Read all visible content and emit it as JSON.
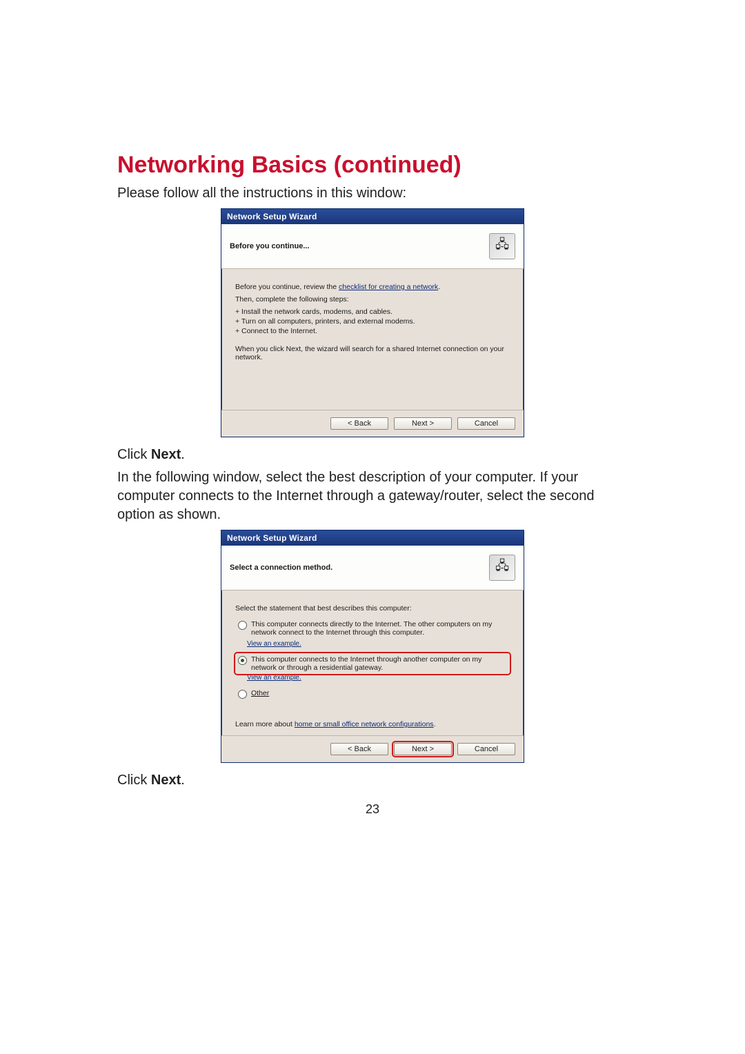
{
  "title": "Networking Basics (continued)",
  "intro": "Please follow all the instructions in this window:",
  "click_next_1": "Click ",
  "click_next_bold": "Next",
  "click_next_period": ".",
  "midtext": "In the following window, select the best description of your computer. If your computer connects to the Internet through a gateway/router, select the second option as shown.",
  "page_number": "23",
  "wizard1": {
    "titlebar": "Network Setup Wizard",
    "subtitle": "Before you continue...",
    "line_review_pre": "Before you continue, review the ",
    "line_review_link": "checklist for creating a network",
    "line_review_post": ".",
    "line_then": "Then, complete the following steps:",
    "bullet1": "+  Install the network cards, modems, and cables.",
    "bullet2": "+  Turn on all computers, printers, and external modems.",
    "bullet3": "+  Connect to the Internet.",
    "line_search": "When you click Next, the wizard will search for a shared Internet connection on your network.",
    "btn_back": "< Back",
    "btn_next": "Next >",
    "btn_cancel": "Cancel"
  },
  "wizard2": {
    "titlebar": "Network Setup Wizard",
    "subtitle": "Select a connection method.",
    "prompt": "Select the statement that best describes this computer:",
    "opt1": "This computer connects directly to the Internet. The other computers on my network connect to the Internet through this computer.",
    "opt1_link": "View an example.",
    "opt2": "This computer connects to the Internet through another computer on my network or through a residential gateway.",
    "opt2_link": "View an example.",
    "opt3": "Other",
    "learn_pre": "Learn more about ",
    "learn_link": "home or small office network configurations",
    "learn_post": ".",
    "btn_back": "< Back",
    "btn_next": "Next >",
    "btn_cancel": "Cancel"
  }
}
